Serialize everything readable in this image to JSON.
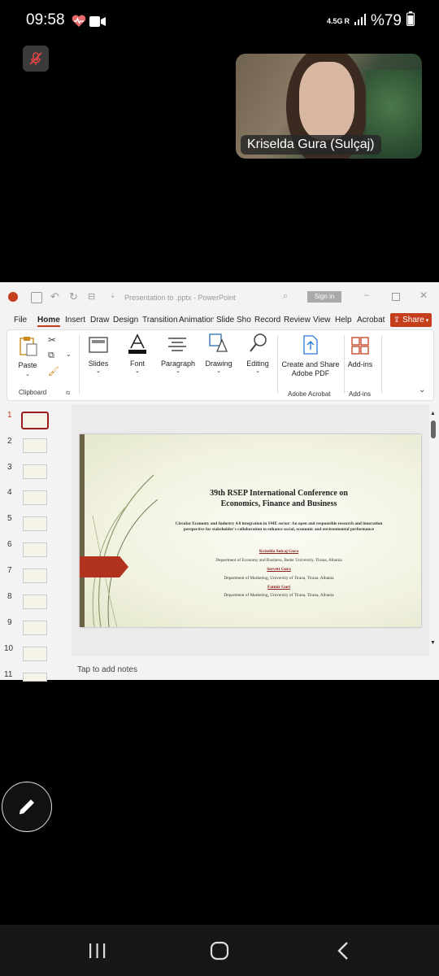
{
  "status_bar": {
    "time": "09:58",
    "network": "4.5G",
    "roaming": "R",
    "battery": "%79"
  },
  "participant": {
    "name": "Kriselda Gura (Sulçaj)"
  },
  "powerpoint": {
    "doc_title": "Presentation to .pptx  -  PowerPoint",
    "sign_in": "Sign in",
    "menu": [
      "File",
      "Home",
      "Insert",
      "Draw",
      "Design",
      "Transition",
      "Animation",
      "Slide Show",
      "Record",
      "Review",
      "View",
      "Help",
      "Acrobat"
    ],
    "share": "Share",
    "ribbon": {
      "paste": "Paste",
      "slides": "Slides",
      "font": "Font",
      "paragraph": "Paragraph",
      "drawing": "Drawing",
      "editing": "Editing",
      "create_share_line1": "Create and Share",
      "create_share_line2": "Adobe PDF",
      "addins": "Add-ins",
      "group_clipboard": "Clipboard",
      "group_acrobat": "Adobe Acrobat",
      "group_addins": "Add-ins"
    },
    "thumbnails": [
      "1",
      "2",
      "3",
      "4",
      "5",
      "6",
      "7",
      "8",
      "9",
      "10",
      "11"
    ],
    "notes_placeholder": "Tap to add notes",
    "slide": {
      "title_line1": "39th RSEP International Conference on",
      "title_line2": "Economics, Finance and Business",
      "subtitle_line1": "Circular Economy and Industry 4.0 integration in SME sector: An open and responsible research and innovation",
      "subtitle_line2": "perspective for stakeholder's collaboration to enhance social, economic and environmental performance",
      "author1": "Kriselda Sulcaj Gura",
      "affil1": "Department of Economy and Business, Beder University, Tirana, Albania",
      "author2": "Servett Gura",
      "affil2": "Department of Marketing, University of Tirana, Tirana, Albania",
      "author3": "Fatmir Guri",
      "affil3": "Department of Marketing, University of Tirana, Tirana, Albania"
    }
  }
}
